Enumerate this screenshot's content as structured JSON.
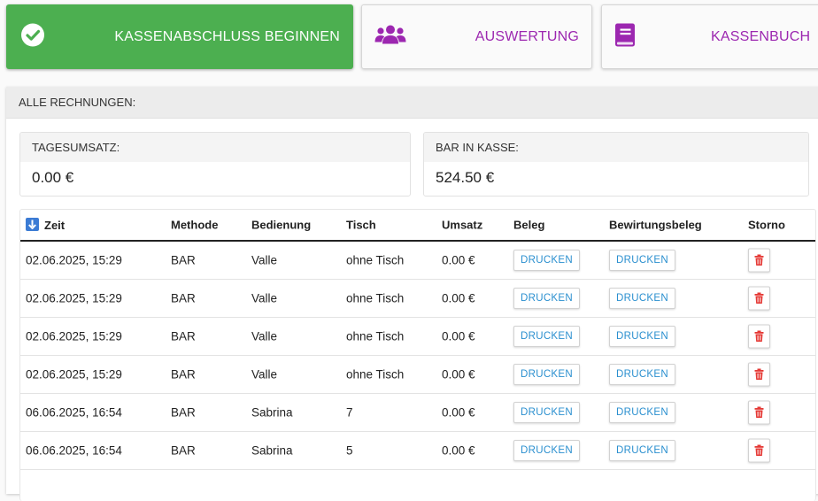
{
  "toolbar": {
    "close_register_label": "KASSENABSCHLUSS BEGINNEN",
    "evaluation_label": "AUSWERTUNG",
    "cashbook_label": "KASSENBUCH",
    "close_register_icon": "check-circle-icon",
    "evaluation_icon": "users-icon",
    "cashbook_icon": "book-icon"
  },
  "panel": {
    "title": "ALLE RECHNUNGEN:"
  },
  "stats": {
    "daily_sales_label": "TAGESUMSATZ:",
    "daily_sales_value": "0.00 €",
    "cash_label": "BAR IN KASSE:",
    "cash_value": "524.50 €"
  },
  "table": {
    "sort_icon": "sort-down-icon",
    "columns": [
      "Zeit",
      "Methode",
      "Bedienung",
      "Tisch",
      "Umsatz",
      "Beleg",
      "Bewirtungsbeleg",
      "Storno"
    ],
    "print_label": "DRUCKEN",
    "delete_icon": "trash-icon",
    "rows": [
      {
        "time": "02.06.2025, 15:29",
        "method": "BAR",
        "server": "Valle",
        "table": "ohne Tisch",
        "sales": "0.00 €"
      },
      {
        "time": "02.06.2025, 15:29",
        "method": "BAR",
        "server": "Valle",
        "table": "ohne Tisch",
        "sales": "0.00 €"
      },
      {
        "time": "02.06.2025, 15:29",
        "method": "BAR",
        "server": "Valle",
        "table": "ohne Tisch",
        "sales": "0.00 €"
      },
      {
        "time": "02.06.2025, 15:29",
        "method": "BAR",
        "server": "Valle",
        "table": "ohne Tisch",
        "sales": "0.00 €"
      },
      {
        "time": "06.06.2025, 16:54",
        "method": "BAR",
        "server": "Sabrina",
        "table": "7",
        "sales": "0.00 €"
      },
      {
        "time": "06.06.2025, 16:54",
        "method": "BAR",
        "server": "Sabrina",
        "table": "5",
        "sales": "0.00 €"
      }
    ]
  },
  "colors": {
    "primary_green": "#4caf50",
    "accent_purple": "#9c27b0",
    "print_blue": "#2a8fcf",
    "delete_red": "#e53935"
  }
}
